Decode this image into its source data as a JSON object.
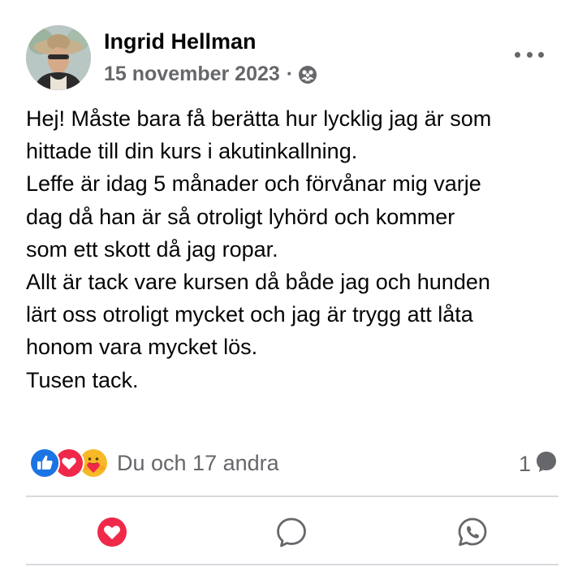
{
  "post": {
    "author": "Ingrid Hellman",
    "date": "15 november 2023",
    "separator": "·",
    "audience_icon": "friends-icon",
    "more_icon": "more-horizontal-icon",
    "body_lines": [
      "Hej! Måste bara få berätta hur lycklig jag är som",
      "hittade till din kurs i akutinkallning.",
      "Leffe är idag 5 månader och förvånar mig varje",
      "dag då han är så otroligt lyhörd och kommer",
      "som ett skott då jag ropar.",
      "Allt är tack vare kursen då både jag och hunden",
      "lärt oss otroligt mycket och jag är trygg att låta",
      "honom vara mycket lös.",
      "Tusen tack."
    ]
  },
  "engagement": {
    "reactions": [
      "like-icon",
      "love-icon",
      "care-icon"
    ],
    "reactions_text": "Du och 17 andra",
    "comments_count": "1",
    "comment_icon": "comment-bubble-icon"
  },
  "actions": [
    {
      "icon": "love-reaction-icon",
      "color": "#f0284a"
    },
    {
      "icon": "comment-icon",
      "color": "#65676b"
    },
    {
      "icon": "whatsapp-icon",
      "color": "#65676b"
    }
  ],
  "colors": {
    "text": "#050505",
    "secondary": "#65676b",
    "like_blue": "#1b74e4",
    "love_red": "#f0284a",
    "care_yellow": "#f7b928",
    "divider": "#d8dadf"
  }
}
